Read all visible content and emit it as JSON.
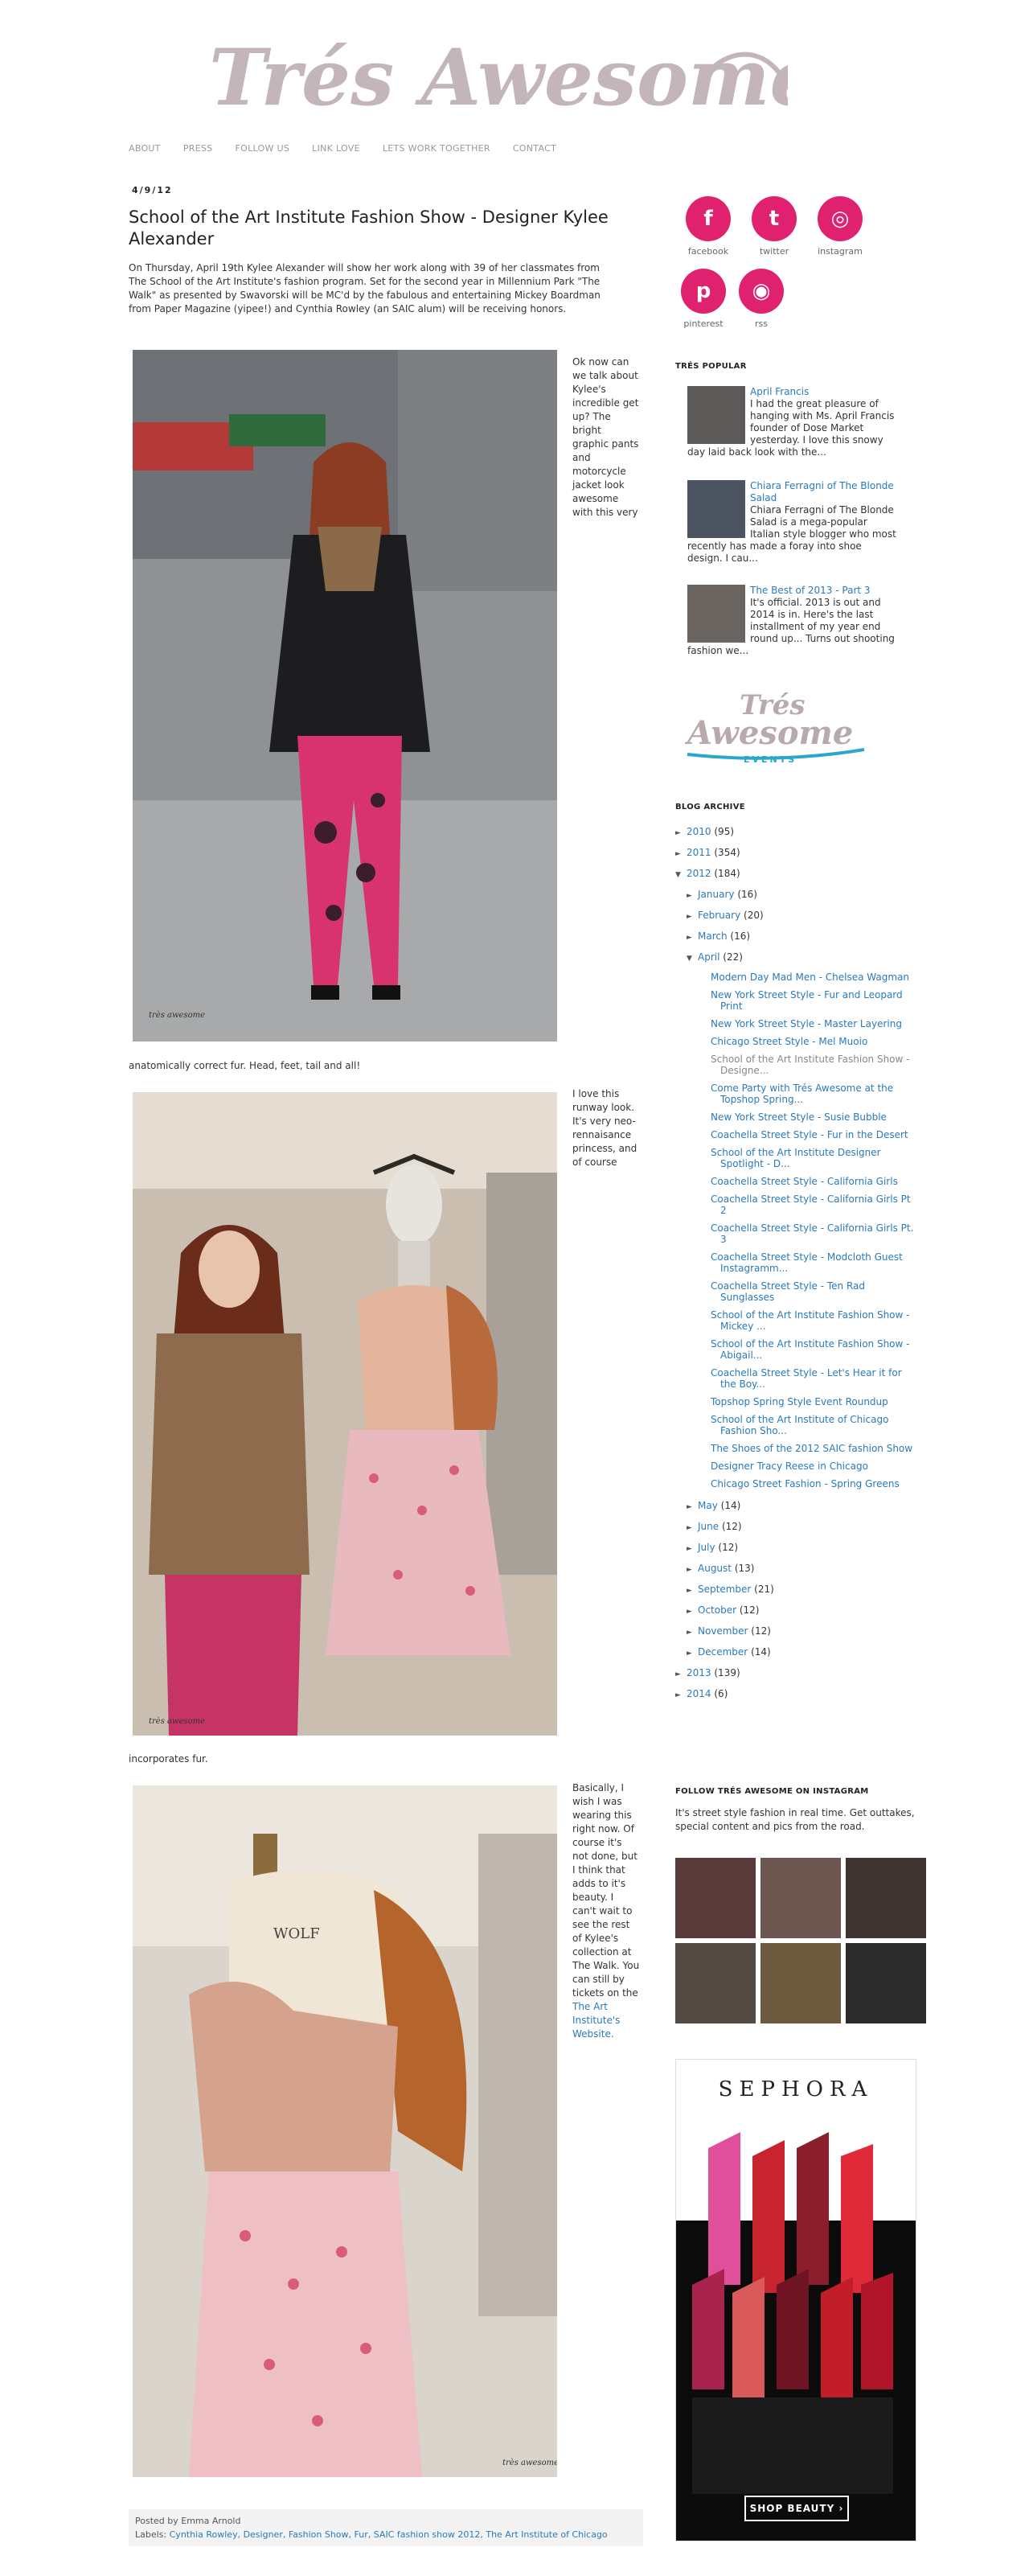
{
  "header": {
    "logo_text": "Trés Awesome"
  },
  "nav": [
    "ABOUT",
    "PRESS",
    "FOLLOW US",
    "LINK LOVE",
    "LETS WORK TOGETHER",
    "CONTACT"
  ],
  "post": {
    "date": "4/9/12",
    "title": "School of the Art Institute Fashion Show - Designer Kylee Alexander",
    "intro": "On Thursday, April 19th Kylee Alexander will show her work along with 39 of her classmates from The School of the Art Institute's fashion program. Set for the second year in Millennium Park \"The Walk\" as presented by Swavorski will be MC'd by the fabulous and entertaining Mickey Boardman from Paper Magazine (yipee!) and Cynthia Rowley (an SAIC alum) will be receiving honors.",
    "caption1": "Ok now can we talk about Kylee's incredible get up?  The bright graphic pants and motorcycle jacket look awesome with this very",
    "after1": "anatomically correct fur. Head, feet, tail and all!",
    "caption2": "I love this runway look. It's very neo-rennaisance princess, and of course",
    "after2": "incorporates fur.",
    "caption3_prefix": "Basically, I wish I was wearing this right now. Of course it's not done, but I think that adds to it's beauty. I can't wait to see the rest of Kylee's collection at The Walk. You can still by tickets on the",
    "caption3_link": "The Art Institute's Website.",
    "watermark": "très awesome",
    "posted_by": "Posted by Emma Arnold",
    "labels_prefix": "Labels:",
    "labels": "Cynthia Rowley, Designer, Fashion Show, Fur, SAIC fashion show 2012, The Art Institute of Chicago"
  },
  "social": [
    {
      "label": "facebook",
      "glyph": "f"
    },
    {
      "label": "twitter",
      "glyph": "t"
    },
    {
      "label": "instagram",
      "glyph": "◎"
    },
    {
      "label": "pinterest",
      "glyph": "p"
    },
    {
      "label": "rss",
      "glyph": "◉"
    }
  ],
  "popular": {
    "title": "TRÉS POPULAR",
    "items": [
      {
        "title": "April Francis",
        "snippet": "I had the great pleasure of hanging with Ms. April Francis founder of Dose Market yesterday. I love this snowy day laid back look with the..."
      },
      {
        "title": "Chiara Ferragni of The Blonde Salad",
        "snippet": "Chiara Ferragni  of The Blonde Salad  is a mega-popular Italian style blogger who most recently has made a foray into shoe design. I cau..."
      },
      {
        "title": "The Best of 2013 - Part 3",
        "snippet": "It's official. 2013 is out and 2014 is in. Here's the last installment of my year end round up... Turns out shooting fashion we..."
      }
    ]
  },
  "events_logo": {
    "line1": "Trés",
    "line2": "Awesome",
    "line3": "EVENTS"
  },
  "archive": {
    "title": "BLOG ARCHIVE",
    "years_top": [
      {
        "year": "2010",
        "count": "(95)"
      },
      {
        "year": "2011",
        "count": "(354)"
      },
      {
        "year": "2012",
        "count": "(184)"
      }
    ],
    "months_before": [
      {
        "month": "January",
        "count": "(16)"
      },
      {
        "month": "February",
        "count": "(20)"
      },
      {
        "month": "March",
        "count": "(16)"
      },
      {
        "month": "April",
        "count": "(22)"
      }
    ],
    "april_posts": [
      "Modern Day Mad Men - Chelsea Wagman",
      "New York Street Style - Fur and Leopard Print",
      "New York Street Style - Master Layering",
      "Chicago Street Style - Mel Muoio",
      "School of the Art Institute Fashion Show - Designe...",
      "Come Party with Trés Awesome at the Topshop Spring...",
      "New York Street Style - Susie Bubble",
      "Coachella Street Style - Fur in the Desert",
      "School of the Art Institute Designer Spotlight - D...",
      "Coachella Street Style - California Girls",
      "Coachella Street Style - California Girls Pt 2",
      "Coachella Street Style - California Girls Pt. 3",
      "Coachella Street Style - Modcloth Guest Instagramm...",
      "Coachella Street Style - Ten Rad Sunglasses",
      "School of the Art Institute Fashion Show - Mickey ...",
      "School of the Art Institute Fashion Show - Abigail...",
      "Coachella Street Style - Let's Hear it for the Boy...",
      "Topshop Spring Style Event Roundup",
      "School of the Art Institute of Chicago Fashion Sho...",
      "The Shoes of the 2012 SAIC fashion Show",
      "Designer Tracy Reese in Chicago",
      "Chicago Street Fashion - Spring Greens"
    ],
    "months_after": [
      {
        "month": "May",
        "count": "(14)"
      },
      {
        "month": "June",
        "count": "(12)"
      },
      {
        "month": "July",
        "count": "(12)"
      },
      {
        "month": "August",
        "count": "(13)"
      },
      {
        "month": "September",
        "count": "(21)"
      },
      {
        "month": "October",
        "count": "(12)"
      },
      {
        "month": "November",
        "count": "(12)"
      },
      {
        "month": "December",
        "count": "(14)"
      }
    ],
    "years_bottom": [
      {
        "year": "2013",
        "count": "(139)"
      },
      {
        "year": "2014",
        "count": "(6)"
      }
    ]
  },
  "instagram": {
    "title": "FOLLOW TRÉS AWESOME ON INSTAGRAM",
    "text": "It's street style fashion in real time. Get outtakes, special content and pics from the road."
  },
  "ad": {
    "brand": "SEPHORA",
    "cta": "SHOP BEAUTY ›"
  }
}
